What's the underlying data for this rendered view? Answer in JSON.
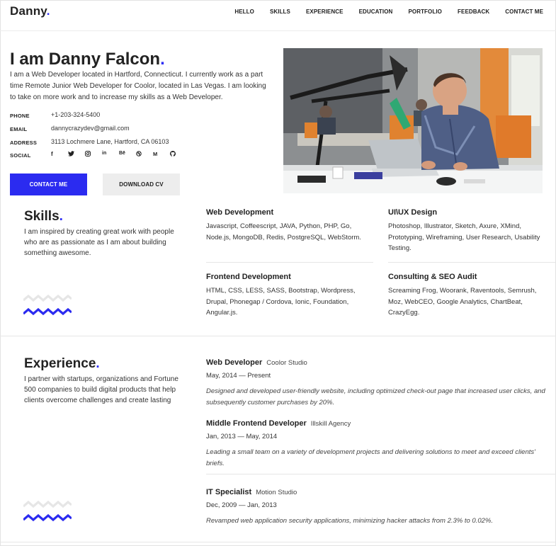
{
  "header": {
    "logo_text": "Danny",
    "logo_dot": ".",
    "nav": [
      "HELLO",
      "SKILLS",
      "EXPERIENCE",
      "EDUCATION",
      "PORTFOLIO",
      "FEEDBACK",
      "CONTACT ME"
    ]
  },
  "hero": {
    "title": "I am Danny Falcon",
    "title_dot": ".",
    "intro": "I am a Web Developer located in Hartford, Connecticut. I currently work as a part time Remote Junior Web Developer for Coolor, located in Las Vegas. I am looking to take on more work and to increase my skills as a Web Developer.",
    "info": [
      {
        "label": "PHONE",
        "value": "+1-203-324-5400"
      },
      {
        "label": "EMAIL",
        "value": "dannycrazydev@gmail.com"
      },
      {
        "label": "ADDRESS",
        "value": "3113 Lochmere Lane, Hartford, CA 06103"
      }
    ],
    "social_label": "SOCIAL",
    "social_icons": [
      "facebook-icon",
      "twitter-icon",
      "instagram-icon",
      "linkedin-icon",
      "behance-icon",
      "dribbble-icon",
      "medium-icon",
      "github-icon"
    ],
    "social_glyphs": [
      "f",
      "🐦",
      "◎",
      "in",
      "Bē",
      "◉",
      "M",
      "◐"
    ],
    "contact_button": "CONTACT ME",
    "download_button": "DOWNLOAD CV"
  },
  "skills": {
    "title": "Skills",
    "title_dot": ".",
    "description": "I am inspired by creating great work with people who are as passionate as I am about building something awesome.",
    "items": [
      {
        "name": "Web Development",
        "details": "Javascript, Coffeescript, JAVA, Python, PHP, Go, Node.js, MongoDB, Redis, PostgreSQL, WebStorm."
      },
      {
        "name": "UI\\UX Design",
        "details": "Photoshop, Illustrator, Sketch, Axure, XMind, Prototyping, Wireframing, User Research, Usability Testing."
      },
      {
        "name": "Frontend Development",
        "details": "HTML, CSS, LESS, SASS, Bootstrap, Wordpress, Drupal, Phonegap / Cordova, Ionic, Foundation, Angular.js."
      },
      {
        "name": "Consulting & SEO Audit",
        "details": "Screaming Frog, Woorank, Raventools, Semrush, Moz, WebCEO, Google Analytics, ChartBeat, CrazyEgg."
      }
    ]
  },
  "experience": {
    "title": "Experience",
    "title_dot": ".",
    "description": "I partner with startups, organizations and Fortune 500 companies to build digital products that help clients overcome challenges and create lasting",
    "jobs": [
      {
        "role": "Web Developer",
        "company": "Coolor Studio",
        "dates": "May, 2014 — Present",
        "description": "Designed and developed user-friendly website, including optimized check-out page that increased user clicks, and subsequently customer purchases by 20%."
      },
      {
        "role": "Middle Frontend Developer",
        "company": "Illskill Agency",
        "dates": "Jan, 2013 — May, 2014",
        "description": "Leading a small team on a variety of development projects and delivering solutions to meet and exceed clients' briefs."
      },
      {
        "role": "IT Specialist",
        "company": "Motion Studio",
        "dates": "Dec, 2009 — Jan, 2013",
        "description": "Revamped web application security applications, minimizing hacker attacks from 2.3% to 0.02%."
      }
    ]
  },
  "colors": {
    "accent": "#2b2bf0",
    "wave_light": "#e6e6e6",
    "text": "#222222"
  }
}
